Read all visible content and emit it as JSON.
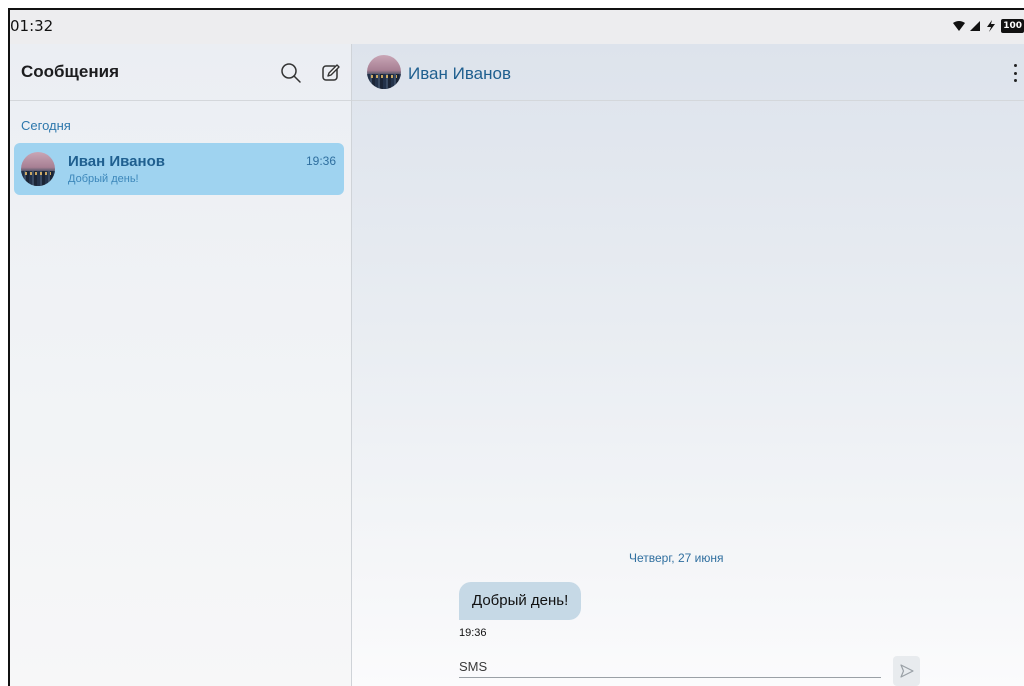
{
  "status_bar": {
    "time": "01:32",
    "battery": "100",
    "icons": [
      "wifi-icon",
      "signal-icon",
      "charging-icon",
      "battery-icon"
    ]
  },
  "conversations_panel": {
    "title": "Сообщения",
    "section_label": "Сегодня",
    "items": [
      {
        "name": "Иван Иванов",
        "preview": "Добрый день!",
        "time": "19:36",
        "selected": true
      }
    ]
  },
  "chat": {
    "contact_name": "Иван Иванов",
    "date_separator": "Четверг, 27 июня",
    "messages": [
      {
        "text": "Добрый день!",
        "time": "19:36",
        "direction": "incoming"
      }
    ],
    "input": {
      "placeholder": "SMS",
      "value": ""
    }
  },
  "colors": {
    "accent": "#2e78ad",
    "selected_item": "#9fd3f0",
    "bubble": "#c6d9e6"
  }
}
